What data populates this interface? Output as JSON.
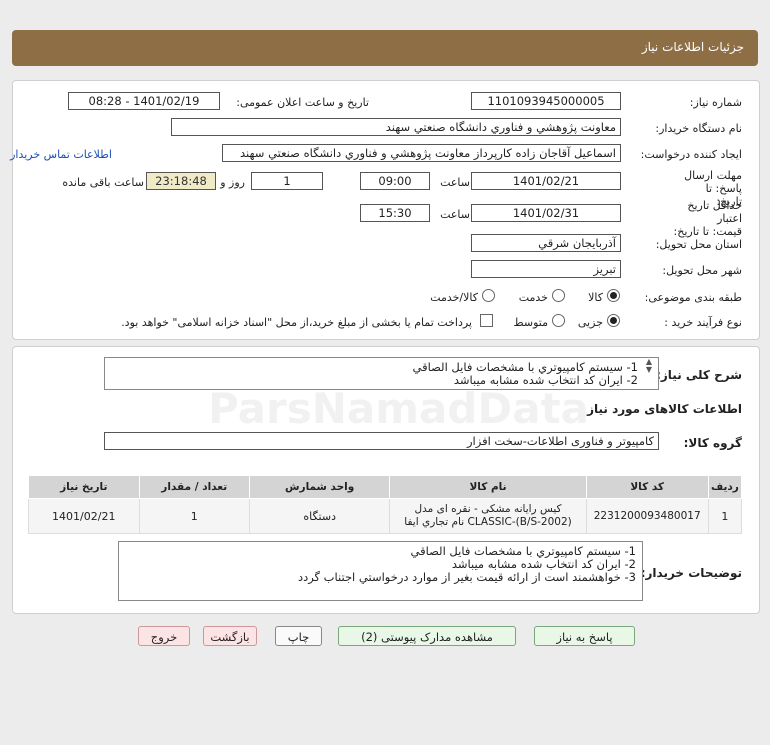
{
  "header": {
    "title": "جزئیات اطلاعات نیاز"
  },
  "form": {
    "need_number": {
      "label": "شماره نیاز:",
      "value": "1101093945000005"
    },
    "announce_datetime": {
      "label": "تاریخ و ساعت اعلان عمومی:",
      "value": "1401/02/19 - 08:28"
    },
    "buyer_org": {
      "label": "نام دستگاه خریدار:",
      "value": "معاونت پژوهشي و فناوري دانشگاه صنعتي سهند"
    },
    "requester": {
      "label": "ایجاد کننده درخواست:",
      "value": "اسماعيل آقاجان زاده کارپرداز معاونت پژوهشي و فناوري دانشگاه صنعتي سهند"
    },
    "contact_link": "اطلاعات تماس خریدار",
    "response_deadline": {
      "label": "مهلت ارسال پاسخ: تا تاریخ:",
      "date": "1401/02/21",
      "time_label": "ساعت",
      "time": "09:00",
      "days": "1",
      "days_label": "روز و",
      "remaining": "23:18:48",
      "remaining_label": "ساعت باقی مانده"
    },
    "price_validity": {
      "label": "حداقل تاریخ اعتبار قیمت: تا تاریخ:",
      "date": "1401/02/31",
      "time_label": "ساعت",
      "time": "15:30"
    },
    "delivery_province": {
      "label": "استان محل تحویل:",
      "value": "آذربايجان شرقي"
    },
    "delivery_city": {
      "label": "شهر محل تحویل:",
      "value": "تبريز"
    },
    "category": {
      "label": "طبقه بندی موضوعی:",
      "options": [
        "کالا",
        "خدمت",
        "کالا/خدمت"
      ],
      "selected": "کالا"
    },
    "process_type": {
      "label": "نوع فرآیند خرید :",
      "options": [
        "جزیی",
        "متوسط"
      ],
      "selected": "جزیی",
      "payment_note": "پرداخت تمام یا بخشی از مبلغ خرید،از محل \"اسناد خزانه اسلامی\" خواهد بود."
    }
  },
  "summary": {
    "label": "شرح کلی نیاز:",
    "lines": [
      "1- سيستم کامپيوتري با مشخصات فايل الصاقي",
      "2- ايران کد انتخاب شده مشابه ميباشد"
    ]
  },
  "goods_info": {
    "title": "اطلاعات کالاهای مورد نیاز",
    "group_label": "گروه کالا:",
    "group_value": "کامپیوتر و فناوری اطلاعات-سخت افزار"
  },
  "table": {
    "headers": [
      "ردیف",
      "کد کالا",
      "نام کالا",
      "واحد شمارش",
      "تعداد / مقدار",
      "تاریخ نیاز"
    ],
    "rows": [
      {
        "row": "1",
        "code": "2231200093480017",
        "name": "کيس رايانه مشکی - نقره ای مدل CLASSIC-(B/S-2002) نام تجاري ايفا",
        "unit": "دستگاه",
        "qty": "1",
        "date": "1401/02/21"
      }
    ]
  },
  "buyer_notes": {
    "label": "توضیحات خریدار:",
    "lines": [
      "1- سيستم کامپيوتري با مشخصات فايل الصاقي",
      "2- ايران کد انتخاب شده مشابه ميباشد",
      "3- خواهشمند است از ارائه قيمت بغير از موارد درخواستي اجتناب گردد"
    ]
  },
  "buttons": {
    "reply": "پاسخ به نیاز",
    "attachments": "مشاهده مدارک پیوستی (2)",
    "print": "چاپ",
    "back": "بازگشت",
    "exit": "خروج"
  },
  "watermark": {
    "brand": "ParsNamadData"
  },
  "colors": {
    "header_bg": "#8d6e45",
    "link": "#1a4fb5",
    "remaining_bg": "#f0eac6"
  }
}
